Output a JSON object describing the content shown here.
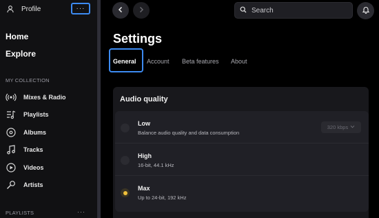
{
  "sidebar": {
    "profile": {
      "label": "Profile",
      "menu": "···"
    },
    "primary": [
      {
        "label": "Home"
      },
      {
        "label": "Explore"
      }
    ],
    "collection_title": "MY COLLECTION",
    "collection": [
      {
        "label": "Mixes & Radio",
        "icon": "radio-waves-icon"
      },
      {
        "label": "Playlists",
        "icon": "playlist-icon"
      },
      {
        "label": "Albums",
        "icon": "album-icon"
      },
      {
        "label": "Tracks",
        "icon": "music-note-icon"
      },
      {
        "label": "Videos",
        "icon": "video-icon"
      },
      {
        "label": "Artists",
        "icon": "microphone-icon"
      }
    ],
    "playlists_title": "PLAYLISTS",
    "playlists_menu": "···"
  },
  "topbar": {
    "search_placeholder": "Search"
  },
  "page": {
    "title": "Settings",
    "tabs": [
      {
        "label": "General",
        "active": true
      },
      {
        "label": "Account",
        "active": false
      },
      {
        "label": "Beta features",
        "active": false
      },
      {
        "label": "About",
        "active": false
      }
    ]
  },
  "audio_quality": {
    "title": "Audio quality",
    "options": [
      {
        "title": "Low",
        "desc": "Balance audio quality and data consumption",
        "selected": false,
        "bitrate": "320 kbps"
      },
      {
        "title": "High",
        "desc": "16-bit, 44.1 kHz",
        "selected": false
      },
      {
        "title": "Max",
        "desc": "Up to 24-bit, 192 kHz",
        "selected": true
      }
    ]
  },
  "colors": {
    "accent_focus": "#3d8bf2",
    "selected_radio": "#f0c03a",
    "sidebar_bg": "#111113"
  }
}
